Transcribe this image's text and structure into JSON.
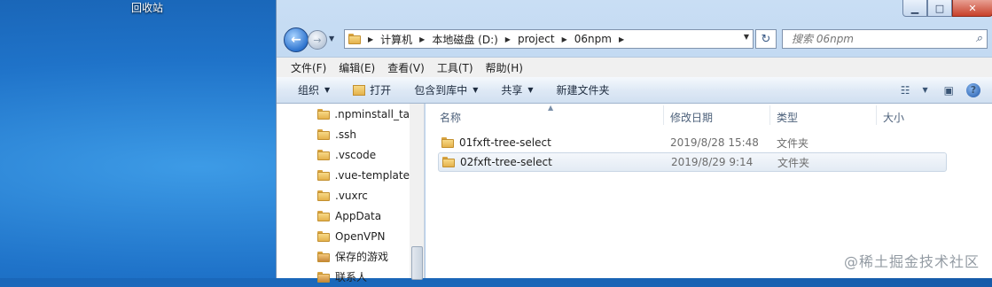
{
  "desktop": {
    "recycle_bin_label": "回收站"
  },
  "window": {
    "controls": {
      "minimize": "▁",
      "maximize": "□",
      "close": "✕"
    },
    "address": {
      "crumbs": [
        "计算机",
        "本地磁盘 (D:)",
        "project",
        "06npm"
      ],
      "search_placeholder": "搜索 06npm"
    },
    "menu": [
      "文件(F)",
      "编辑(E)",
      "查看(V)",
      "工具(T)",
      "帮助(H)"
    ],
    "toolbar": {
      "organize": "组织",
      "open": "打开",
      "include_in_library": "包含到库中",
      "share": "共享",
      "new_folder": "新建文件夹"
    },
    "nav_pane": {
      "items": [
        ".npminstall_ta",
        ".ssh",
        ".vscode",
        ".vue-template",
        ".vuxrc",
        "AppData",
        "OpenVPN",
        "保存的游戏",
        "联系人"
      ]
    },
    "columns": {
      "name": "名称",
      "modified": "修改日期",
      "type": "类型",
      "size": "大小"
    },
    "files": [
      {
        "name": "01fxft-tree-select",
        "modified": "2019/8/28 15:48",
        "type": "文件夹"
      },
      {
        "name": "02fxft-tree-select",
        "modified": "2019/8/29 9:14",
        "type": "文件夹"
      }
    ]
  },
  "watermark": "@稀土掘金技术社区"
}
